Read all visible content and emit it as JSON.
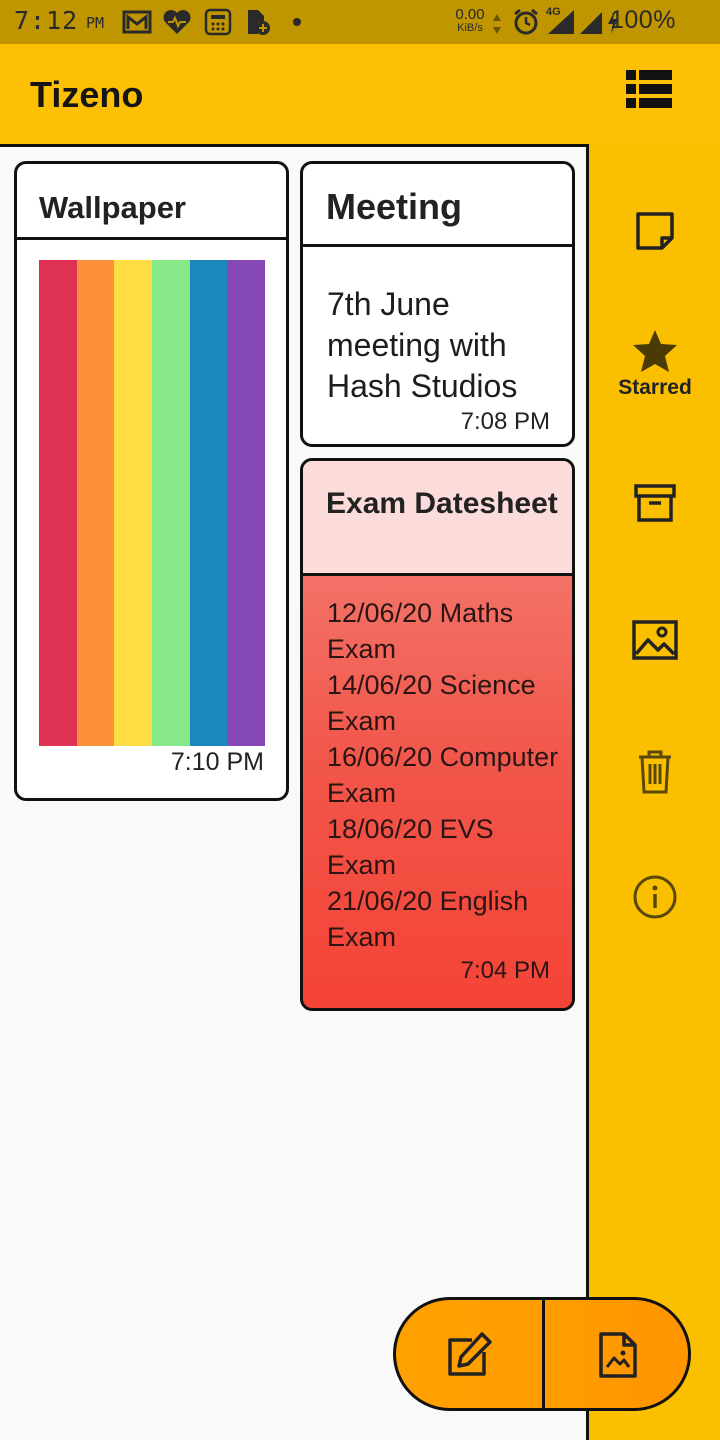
{
  "status_bar": {
    "time": "7:12",
    "ampm": "PM",
    "net_speed": "0.00",
    "net_unit": "KiB/s",
    "network_type": "4G",
    "battery": "100%",
    "icons": [
      "gmail-icon",
      "health-icon",
      "calculator-icon",
      "file-add-icon",
      "dot-icon",
      "alarm-icon",
      "signal-icon",
      "signal-icon",
      "charging-icon"
    ]
  },
  "app_bar": {
    "title": "Tizeno",
    "view_toggle_icon": "list-view-icon"
  },
  "notes": [
    {
      "title": "Wallpaper",
      "time": "7:10 PM",
      "image_colors": [
        "#e03354",
        "#fd913a",
        "#fddc44",
        "#86e888",
        "#1b88be",
        "#8648b5"
      ]
    },
    {
      "title": "Meeting",
      "body": "7th June meeting with Hash Studios",
      "time": "7:08 PM"
    },
    {
      "title": "Exam Datesheet",
      "body": "12/06/20 Maths Exam\n14/06/20 Science Exam\n16/06/20 Computer Exam\n18/06/20 EVS Exam\n21/06/20 English Exam",
      "time": "7:04 PM"
    }
  ],
  "sidebar": {
    "items": [
      {
        "icon": "note-icon",
        "label": ""
      },
      {
        "icon": "star-icon",
        "label": "Starred"
      },
      {
        "icon": "archive-icon",
        "label": ""
      },
      {
        "icon": "image-icon",
        "label": ""
      },
      {
        "icon": "trash-icon",
        "label": ""
      },
      {
        "icon": "info-icon",
        "label": ""
      }
    ]
  },
  "fab": {
    "new_note_icon": "edit-note-icon",
    "new_image_note_icon": "image-note-icon"
  },
  "colors": {
    "accent": "#fdc004",
    "status_bar": "#c09600",
    "fab": "#ff9c00",
    "exam_card": "#f44336",
    "exam_card_header": "#fcdcda"
  }
}
